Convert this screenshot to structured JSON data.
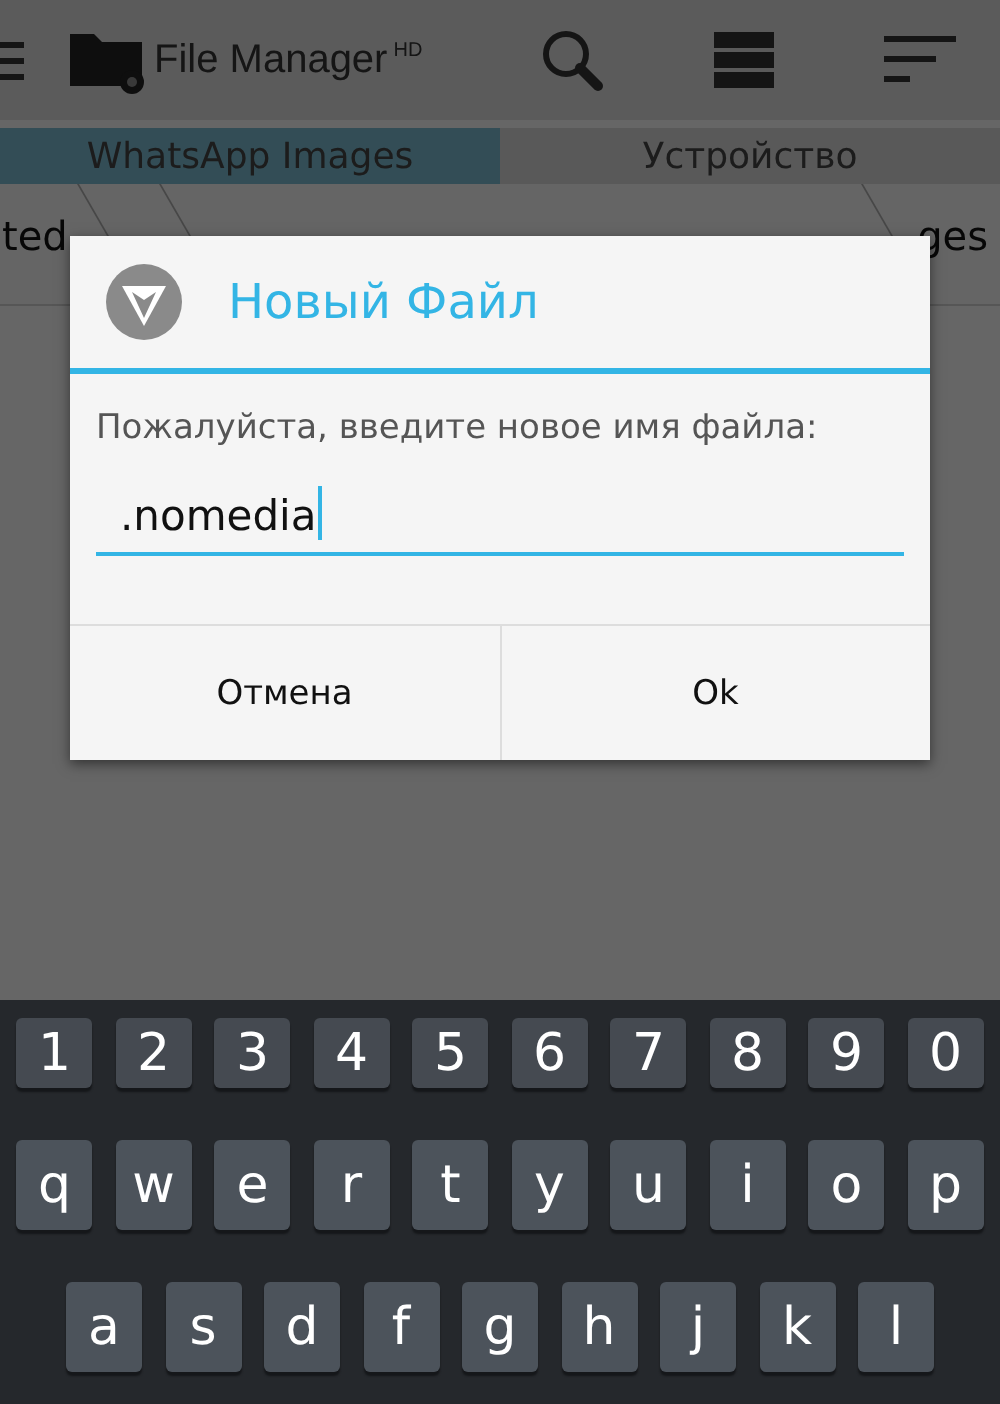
{
  "app_bar": {
    "title": "File Manager",
    "title_sup": "HD"
  },
  "tabs": [
    {
      "label": "WhatsApp Images",
      "selected": true
    },
    {
      "label": "Устройство",
      "selected": false
    }
  ],
  "breadcrumbs": [
    "ted",
    "ges"
  ],
  "dialog": {
    "title": "Новый Файл",
    "message": "Пожалуйста, введите новое имя файла:",
    "value": ".nomedia",
    "buttons": [
      "Отмена",
      "Ok"
    ]
  },
  "keyboard": {
    "rows": [
      [
        "1",
        "2",
        "3",
        "4",
        "5",
        "6",
        "7",
        "8",
        "9",
        "0"
      ],
      [
        "q",
        "w",
        "e",
        "r",
        "t",
        "y",
        "u",
        "i",
        "o",
        "p"
      ],
      [
        "a",
        "s",
        "d",
        "f",
        "g",
        "h",
        "j",
        "k",
        "l"
      ]
    ]
  }
}
